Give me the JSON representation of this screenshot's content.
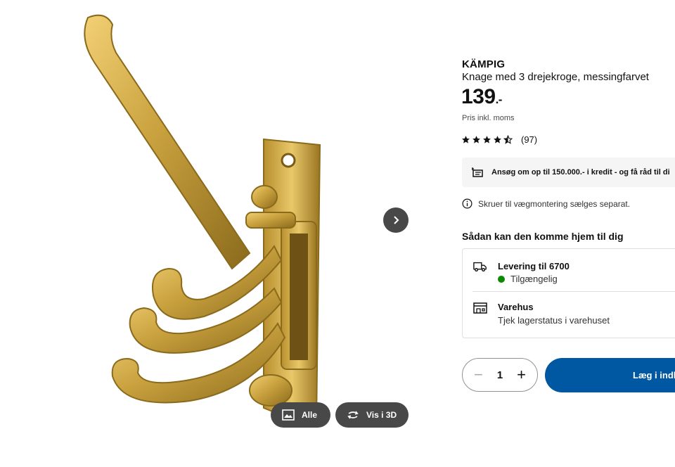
{
  "gallery": {
    "all_label": "Alle",
    "view3d_label": "Vis i 3D"
  },
  "product": {
    "name": "KÄMPIG",
    "description": "Knage med 3 drejekroge, messingfarvet",
    "price": "139",
    "price_suffix": ".-",
    "vat_note": "Pris inkl. moms",
    "rating_stars": 4.5,
    "review_count": "(97)"
  },
  "credit": {
    "text": "Ansøg om op til 150.000.- i kredit - og få råd til di"
  },
  "info_note": "Skruer til vægmontering sælges separat.",
  "delivery": {
    "title": "Sådan kan den komme hjem til dig",
    "home": {
      "title": "Levering til 6700",
      "status": "Tilgængelig",
      "status_color": "#0a8a00"
    },
    "store": {
      "title": "Varehus",
      "status": "Tjek lagerstatus i varehuset"
    }
  },
  "cart": {
    "quantity": "1",
    "add_label": "Læg i indk"
  },
  "colors": {
    "brand_blue": "#0058a3",
    "gold": "#c9a13e"
  }
}
